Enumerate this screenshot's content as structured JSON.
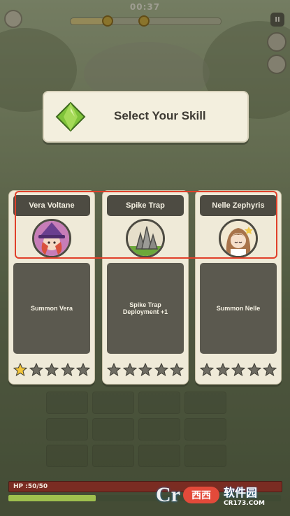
{
  "hud": {
    "timer": "00:37",
    "stage_progress": 0.22,
    "pause_label": "II"
  },
  "title_panel": {
    "title": "Select Your Skill",
    "icon": "green-gem-icon"
  },
  "cards": [
    {
      "name": "Vera Voltane",
      "description": "Summon Vera",
      "portrait": "witch-portrait-icon",
      "stars_filled": 1,
      "stars_total": 5
    },
    {
      "name": "Spike Trap",
      "description": "Spike Trap Deployment +1",
      "portrait": "spike-trap-icon",
      "stars_filled": 0,
      "stars_total": 5
    },
    {
      "name": "Nelle Zephyris",
      "description": "Summon Nelle",
      "portrait": "priestess-portrait-icon",
      "stars_filled": 0,
      "stars_total": 5
    }
  ],
  "player": {
    "hp_label": "HP :50/50",
    "hp_fraction": 1.0,
    "xp_fraction": 0.32
  },
  "watermark": {
    "logo": "Cr",
    "badge": "西西",
    "site_name": "软件园",
    "url": "CR173.COM"
  },
  "colors": {
    "highlight": "#e0402a",
    "card_bg": "#efead8",
    "name_plate": "#4d4b42",
    "star_filled": "#f3c63b",
    "star_empty": "#6f6d63"
  }
}
